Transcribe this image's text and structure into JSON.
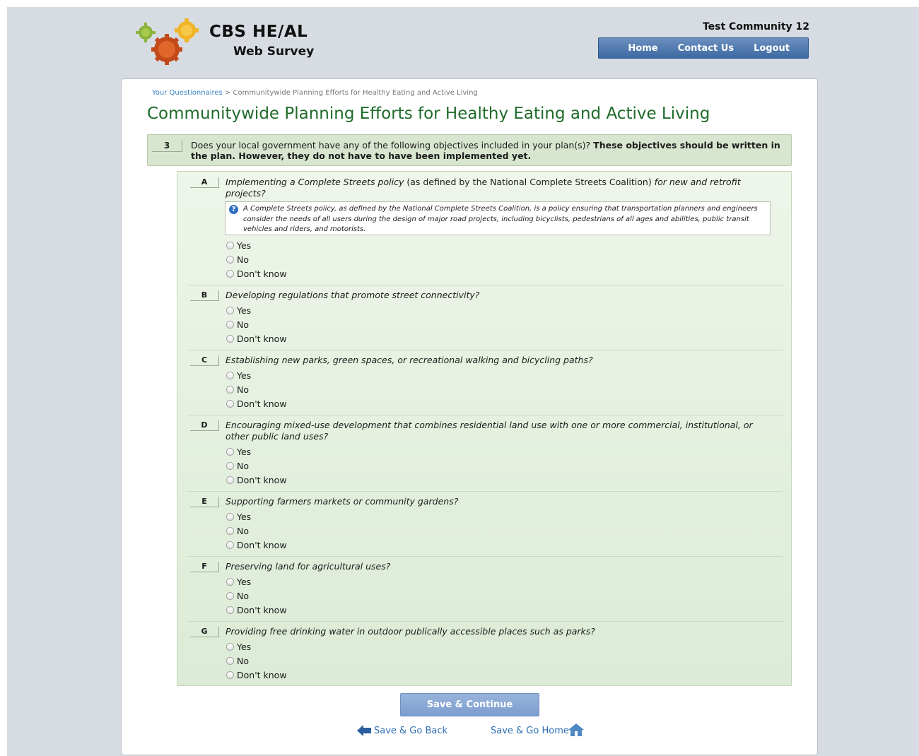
{
  "header": {
    "brand_title": "CBS HE/AL",
    "brand_subtitle": "Web Survey",
    "community": "Test Community 12",
    "nav": [
      "Home",
      "Contact Us",
      "Logout"
    ]
  },
  "breadcrumb": {
    "link": "Your Questionnaires",
    "separator": ">",
    "current": "Communitywide Planning Efforts for Healthy Eating and Active Living"
  },
  "page_title": "Communitywide Planning Efforts for Healthy Eating and Active Living",
  "question": {
    "number": "3",
    "text": "Does your local government have any of the following objectives included in your plan(s)?",
    "text_bold": "These objectives should be written in the plan. However, they do not have to have been implemented yet."
  },
  "items": [
    {
      "letter": "A",
      "text_parts": [
        "Implementing a Complete Streets policy",
        " (as defined by the National Complete Streets Coalition) ",
        "for new and retrofit projects?"
      ],
      "info": "A Complete Streets policy, as defined by the National Complete Streets Coalition, is a policy ensuring that transportation planners and engineers consider the needs of all users during the design of major road projects, including bicyclists, pedestrians of all ages and abilities, public transit vehicles and riders, and motorists."
    },
    {
      "letter": "B",
      "text": "Developing regulations that promote street connectivity?"
    },
    {
      "letter": "C",
      "text": "Establishing new parks, green spaces, or recreational walking and bicycling paths?"
    },
    {
      "letter": "D",
      "text": "Encouraging mixed-use development that combines residential land use with one or more commercial, institutional, or other public land uses?"
    },
    {
      "letter": "E",
      "text": "Supporting farmers markets or community gardens?"
    },
    {
      "letter": "F",
      "text": "Preserving land for agricultural uses?"
    },
    {
      "letter": "G",
      "text": "Providing free drinking water in outdoor publically accessible places such as parks?"
    }
  ],
  "options": [
    "Yes",
    "No",
    "Don't know"
  ],
  "actions": {
    "save_continue": "Save & Continue",
    "save_back": "Save & Go Back",
    "save_home": "Save & Go Home"
  },
  "icons": [
    "logo-gears-icon",
    "info-icon",
    "back-arrow-icon",
    "home-icon"
  ],
  "colors": {
    "title_green": "#1e6b2a",
    "nav_blue": "#3d6aa3",
    "link_blue": "#2e6fb3",
    "panel_green": "#d9e6cf"
  }
}
